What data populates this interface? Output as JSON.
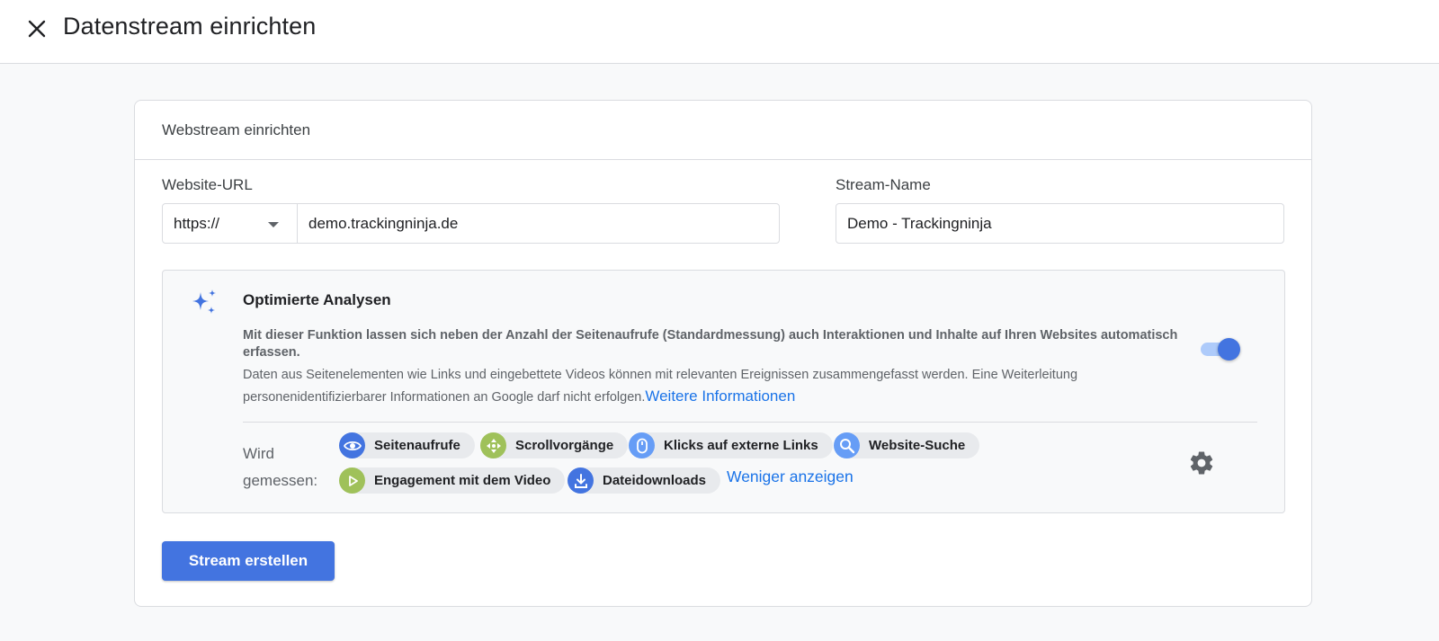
{
  "header": {
    "title": "Datenstream einrichten"
  },
  "card": {
    "title": "Webstream einrichten",
    "url_label": "Website-URL",
    "protocol": "https://",
    "url_value": "demo.trackingninja.de",
    "name_label": "Stream-Name",
    "name_value": "Demo - Trackingninja"
  },
  "enhanced": {
    "title": "Optimierte Analysen",
    "desc_bold": "Mit dieser Funktion lassen sich neben der Anzahl der Seitenaufrufe (Standardmessung) auch Interaktionen und Inhalte auf Ihren Websites automatisch erfassen.",
    "desc_text": "Daten aus Seitenelementen wie Links und eingebettete Videos können mit relevanten Ereignissen zusammengefasst werden. Eine Weiterleitung personenidentifizierbarer Informationen an Google darf nicht erfolgen.",
    "more_info": "Weitere Informationen",
    "toggle_on": true,
    "measured_label": "Wird gemessen:",
    "chips": [
      {
        "label": "Seitenaufrufe",
        "icon": "eye-icon"
      },
      {
        "label": "Scrollvorgänge",
        "icon": "scroll-icon"
      },
      {
        "label": "Klicks auf externe Links",
        "icon": "mouse-icon"
      },
      {
        "label": "Website-Suche",
        "icon": "search-icon"
      },
      {
        "label": "Engagement mit dem Video",
        "icon": "play-icon"
      },
      {
        "label": "Dateidownloads",
        "icon": "download-icon"
      }
    ],
    "show_less": "Weniger anzeigen"
  },
  "actions": {
    "create": "Stream erstellen"
  },
  "colors": {
    "primary": "#4374e0",
    "link": "#1a73e8",
    "green": "#9fc15a"
  }
}
